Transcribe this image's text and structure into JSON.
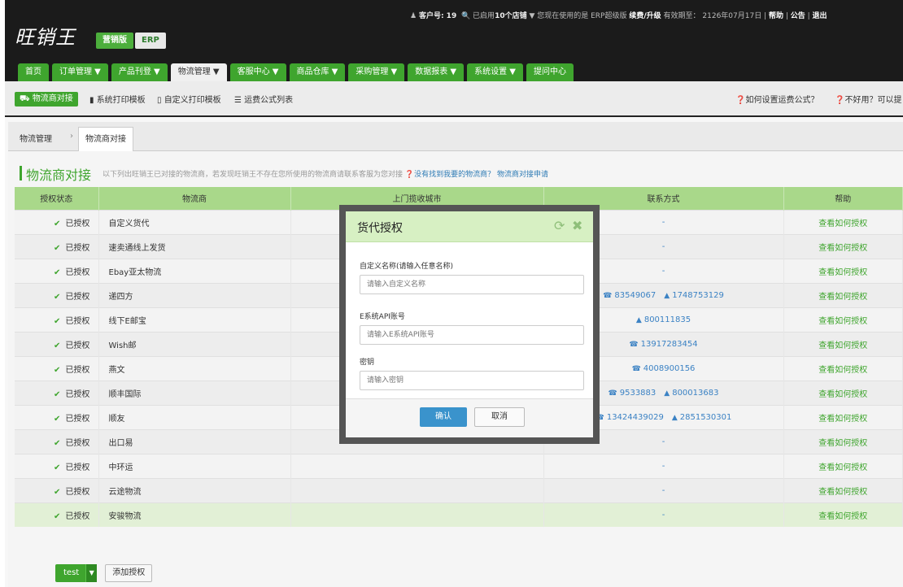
{
  "brand": {
    "logo": "旺销王",
    "edition_primary": "营销版",
    "edition_secondary": "ERP"
  },
  "topinfo": {
    "customer_label": "客户号: 19",
    "shops_prefix": "已启用",
    "shops_count": "10个店铺",
    "version_text": "您现在使用的是 ERP超级版",
    "renew": "续费/升级",
    "expire": "有效期至： 2126年07月17日",
    "help": "帮助",
    "notice": "公告",
    "logout": "退出"
  },
  "nav": {
    "tabs": [
      {
        "label": "首页"
      },
      {
        "label": "订单管理 ▼"
      },
      {
        "label": "产品刊登 ▼"
      },
      {
        "label": "物流管理 ▼"
      },
      {
        "label": "客服中心 ▼"
      },
      {
        "label": "商品仓库 ▼"
      },
      {
        "label": "采购管理 ▼"
      },
      {
        "label": "数据报表 ▼"
      },
      {
        "label": "系统设置 ▼"
      },
      {
        "label": "提问中心"
      }
    ]
  },
  "subnav": {
    "items": [
      {
        "label": "物流商对接"
      },
      {
        "label": "系统打印模板"
      },
      {
        "label": "自定义打印模板"
      },
      {
        "label": "运费公式列表"
      }
    ],
    "help1": "如何设置运费公式？",
    "help2": "不好用？可以提"
  },
  "breadcrumb": {
    "root": "物流管理",
    "current": "物流商对接"
  },
  "page": {
    "title": "物流商对接",
    "desc": "以下列出旺销王已对接的物流商，若发现旺销王不存在您所使用的物流商请联系客服为您对接",
    "link1": "没有找到我要的物流商？",
    "link2": "物流商对接申请"
  },
  "table": {
    "headers": [
      "授权状态",
      "物流商",
      "上门揽收城市",
      "联系方式",
      "帮助"
    ],
    "rows": [
      {
        "status": "已授权",
        "name": "自定义货代",
        "contact": "-",
        "help": "查看如何授权"
      },
      {
        "status": "已授权",
        "name": "速卖通线上发货",
        "contact": "-",
        "help": "查看如何授权"
      },
      {
        "status": "已授权",
        "name": "Ebay亚太物流",
        "contact": "-",
        "help": "查看如何授权"
      },
      {
        "status": "已授权",
        "name": "递四方",
        "phone": "83549067",
        "qq": "1748753129",
        "help": "查看如何授权"
      },
      {
        "status": "已授权",
        "name": "线下E邮宝",
        "qq": "800111835",
        "help": "查看如何授权"
      },
      {
        "status": "已授权",
        "name": "Wish邮",
        "phone": "13917283454",
        "help": "查看如何授权"
      },
      {
        "status": "已授权",
        "name": "燕文",
        "phone": "4008900156",
        "help": "查看如何授权"
      },
      {
        "status": "已授权",
        "name": "顺丰国际",
        "phone": "9533883",
        "qq": "800013683",
        "help": "查看如何授权"
      },
      {
        "status": "已授权",
        "name": "顺友",
        "phone": "13424439029",
        "qq": "2851530301",
        "help": "查看如何授权"
      },
      {
        "status": "已授权",
        "name": "出口易",
        "contact": "-",
        "help": "查看如何授权"
      },
      {
        "status": "已授权",
        "name": "中环运",
        "contact": "-",
        "help": "查看如何授权"
      },
      {
        "status": "已授权",
        "name": "云途物流",
        "contact": "-",
        "help": "查看如何授权"
      },
      {
        "status": "已授权",
        "name": "安骏物流",
        "contact": "-",
        "help": "查看如何授权"
      }
    ]
  },
  "footer": {
    "test_button": "test",
    "add_button": "添加授权"
  },
  "dialog": {
    "title": "货代授权",
    "name_label": "自定义名称(请输入任意名称)",
    "name_placeholder": "请输入自定义名称",
    "api_label": "E系统API账号",
    "api_placeholder": "请输入E系统API账号",
    "key_label": "密钥",
    "key_placeholder": "请输入密钥",
    "confirm": "确认",
    "cancel": "取消"
  },
  "colors": {
    "accent": "#3fa52e",
    "header_green": "#a9d88a",
    "link_blue": "#3b82c4"
  }
}
